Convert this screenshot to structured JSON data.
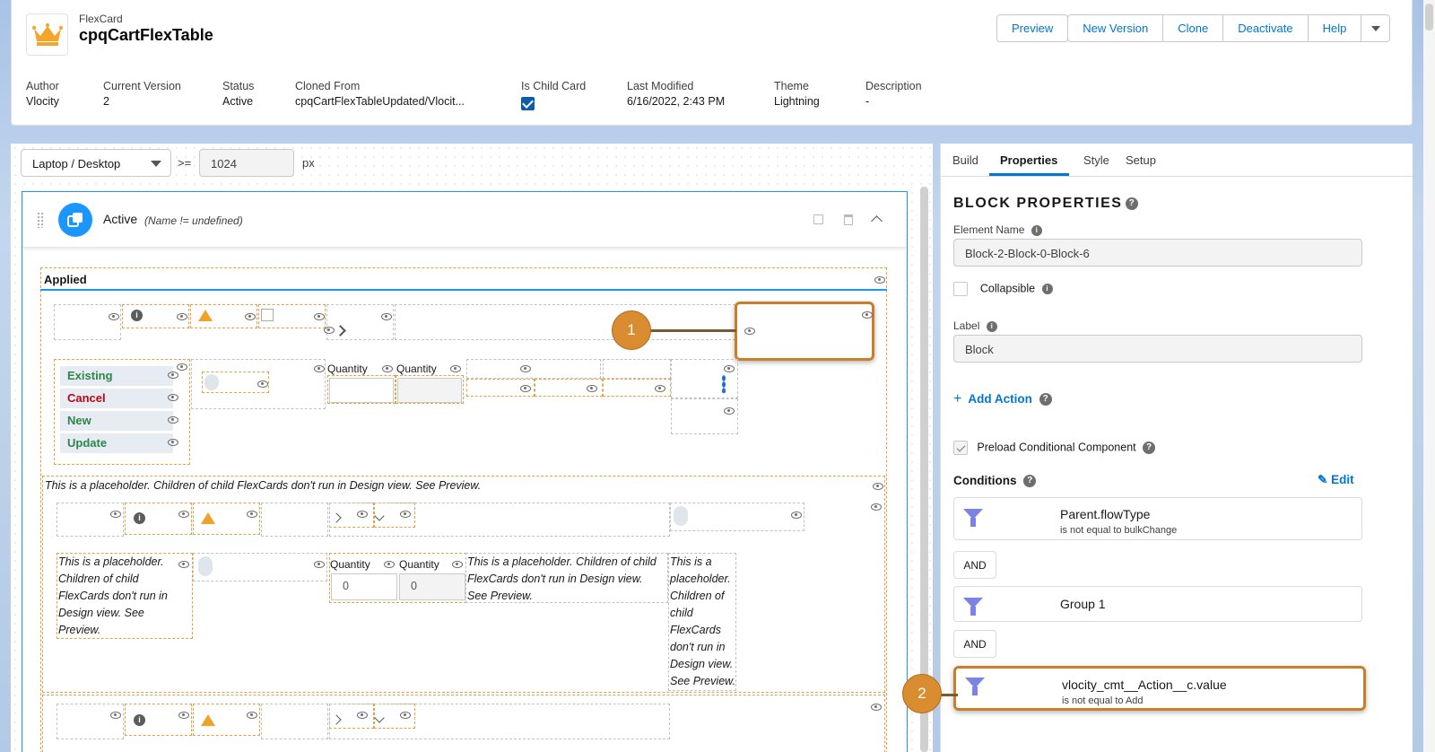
{
  "header": {
    "object_label": "FlexCard",
    "title": "cpqCartFlexTable",
    "buttons": {
      "preview": "Preview",
      "new_version": "New Version",
      "clone": "Clone",
      "deactivate": "Deactivate",
      "help": "Help"
    },
    "fields": {
      "author_label": "Author",
      "author": "Vlocity",
      "version_label": "Current Version",
      "version": "2",
      "status_label": "Status",
      "status": "Active",
      "cloned_label": "Cloned From",
      "cloned": "cpqCartFlexTableUpdated/Vlocit...",
      "child_label": "Is Child Card",
      "modified_label": "Last Modified",
      "modified": "6/16/2022, 2:43 PM",
      "theme_label": "Theme",
      "theme": "Lightning",
      "desc_label": "Description",
      "desc": "-"
    }
  },
  "canvas": {
    "device": "Laptop / Desktop",
    "operator": ">=",
    "width_value": "1024",
    "unit": "px",
    "state_name": "Active",
    "state_condition": "(Name != undefined)",
    "applied_label": "Applied",
    "actions": [
      "Existing",
      "Cancel",
      "New",
      "Update"
    ],
    "quantity_label": "Quantity",
    "qty_value": "0",
    "placeholder_long": "This is a placeholder. Children of child FlexCards don't run in Design view. See Preview.",
    "placeholder_a1": "This is a placeholder.",
    "placeholder_a2": "Children of child",
    "placeholder_a3": "FlexCards don't run in",
    "placeholder_a4": "Design view. See",
    "placeholder_a5": "Preview.",
    "placeholder_b1": "This is a placeholder. Children of child",
    "placeholder_b2": "FlexCards don't run in Design view.",
    "placeholder_b3": "See Preview.",
    "placeholder_c": [
      "This is a",
      "placeholder.",
      "Children of",
      "child",
      "FlexCards",
      "don't run in",
      "Design view.",
      "See Preview."
    ],
    "callout1": "1",
    "callout2": "2"
  },
  "panel": {
    "tabs": [
      "Build",
      "Properties",
      "Style",
      "Setup"
    ],
    "heading": "BLOCK PROPERTIES",
    "element_name_label": "Element Name",
    "element_name": "Block-2-Block-0-Block-6",
    "collapsible_label": "Collapsible",
    "label_label": "Label",
    "label_value": "Block",
    "add_action": "Add Action",
    "preload_label": "Preload Conditional Component",
    "conditions_label": "Conditions",
    "edit": "Edit",
    "and": "AND",
    "conditions": [
      {
        "field": "Parent.flowType",
        "op": "is not equal to bulkChange"
      },
      {
        "field": "Group 1",
        "op": ""
      },
      {
        "field": "vlocity_cmt__Action__c.value",
        "op": "is not equal to Add"
      }
    ]
  },
  "colors": {
    "brand": "#0176d3",
    "accent": "#1b96ff",
    "callout": "#d98c30",
    "existing": "#2e844a",
    "cancel": "#ba0517"
  }
}
